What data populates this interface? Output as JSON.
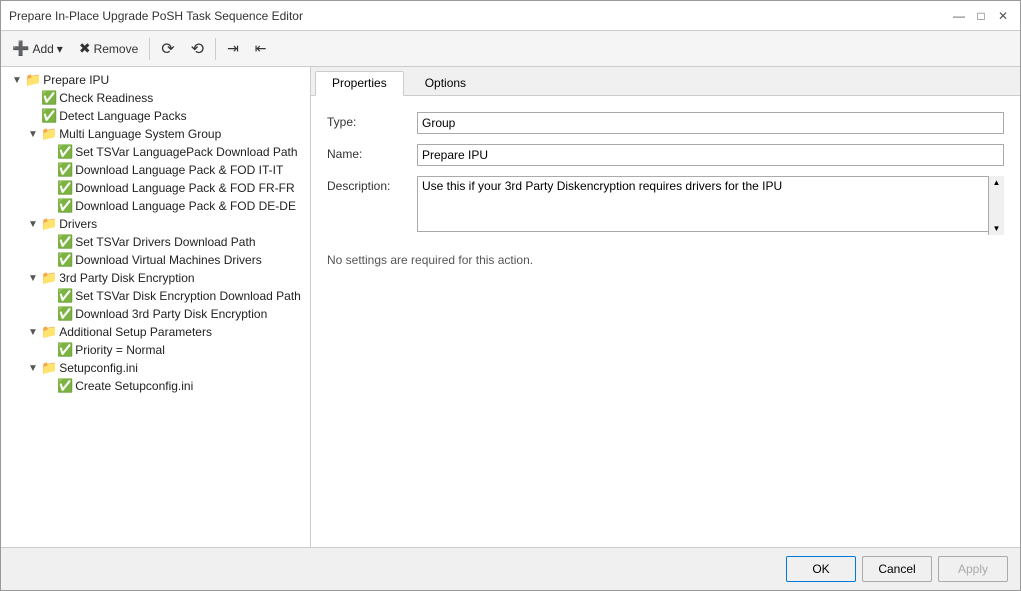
{
  "window": {
    "title": "Prepare In-Place Upgrade PoSH Task Sequence Editor"
  },
  "title_controls": {
    "minimize": "—",
    "maximize": "□",
    "close": "✕"
  },
  "toolbar": {
    "add_label": "Add",
    "remove_label": "Remove",
    "btn_up": "▲",
    "btn_down": "▼",
    "btn_indent": "→",
    "btn_outdent": "←"
  },
  "tabs": [
    {
      "id": "properties",
      "label": "Properties",
      "active": true
    },
    {
      "id": "options",
      "label": "Options",
      "active": false
    }
  ],
  "properties": {
    "type_label": "Type:",
    "type_value": "Group",
    "name_label": "Name:",
    "name_value": "Prepare IPU",
    "description_label": "Description:",
    "description_value": "Use this if your 3rd Party Diskencryption requires drivers for the IPU",
    "no_settings": "No settings are required for this action."
  },
  "tree": {
    "root": {
      "label": "Prepare IPU",
      "expanded": true,
      "children": [
        {
          "label": "Check Readiness",
          "type": "leaf",
          "check": true
        },
        {
          "label": "Detect Language Packs",
          "type": "leaf",
          "check": true
        },
        {
          "label": "Multi Language System Group",
          "type": "group",
          "expanded": true,
          "children": [
            {
              "label": "Set TSVar LanguagePack Download Path",
              "check": true
            },
            {
              "label": "Download Language Pack & FOD IT-IT",
              "check": true
            },
            {
              "label": "Download Language Pack & FOD FR-FR",
              "check": true
            },
            {
              "label": "Download Language Pack & FOD DE-DE",
              "check": true
            }
          ]
        },
        {
          "label": "Drivers",
          "type": "group",
          "expanded": true,
          "children": [
            {
              "label": "Set TSVar Drivers Download Path",
              "check": true
            },
            {
              "label": "Download Virtual Machines Drivers",
              "check": true
            }
          ]
        },
        {
          "label": "3rd Party Disk Encryption",
          "type": "group",
          "expanded": true,
          "children": [
            {
              "label": "Set TSVar Disk Encryption Download Path",
              "check": true
            },
            {
              "label": "Download 3rd Party Disk Encryption",
              "check": true
            }
          ]
        },
        {
          "label": "Additional Setup Parameters",
          "type": "group",
          "expanded": true,
          "children": [
            {
              "label": "Priority = Normal",
              "check": true
            }
          ]
        },
        {
          "label": "Setupconfig.ini",
          "type": "group",
          "expanded": true,
          "children": [
            {
              "label": "Create Setupconfig.ini",
              "check": true
            }
          ]
        }
      ]
    }
  },
  "bottom_buttons": {
    "ok": "OK",
    "cancel": "Cancel",
    "apply": "Apply"
  }
}
